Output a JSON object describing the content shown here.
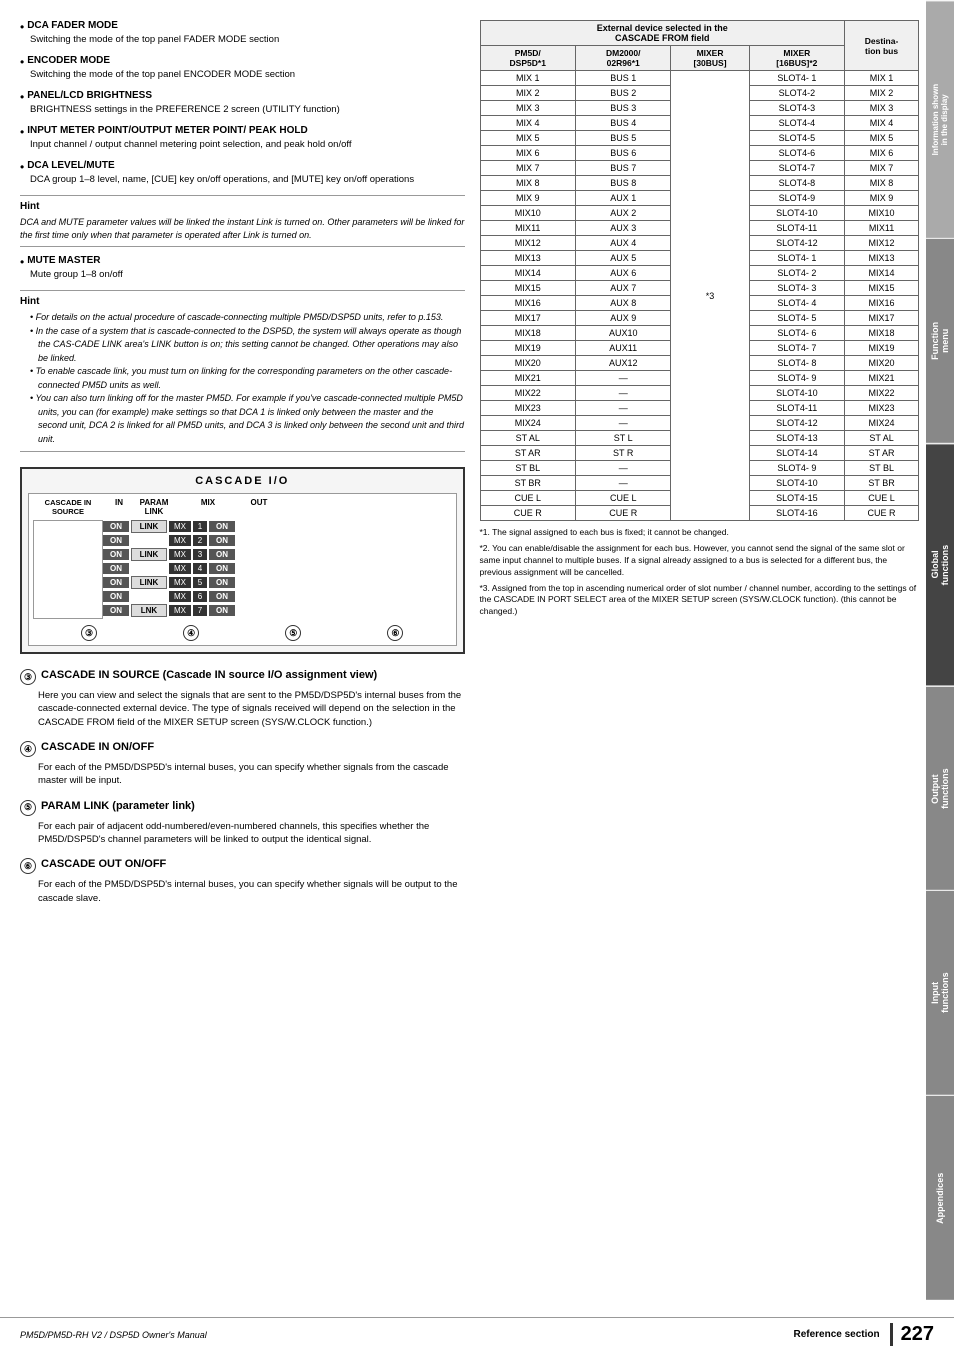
{
  "rightTabs": [
    {
      "label": "Information shown\nin the display",
      "active": false
    },
    {
      "label": "Function\nmenu",
      "active": false
    },
    {
      "label": "Global\nfunctions",
      "active": true
    },
    {
      "label": "Output\nfunctions",
      "active": false
    },
    {
      "label": "Input\nfunctions",
      "active": false
    },
    {
      "label": "Appendices",
      "active": false
    }
  ],
  "leftContent": {
    "bullets": [
      {
        "id": "dca-fader",
        "title": "DCA FADER MODE",
        "desc": "Switching the mode of the top panel FADER MODE section"
      },
      {
        "id": "encoder-mode",
        "title": "ENCODER MODE",
        "desc": "Switching the mode of the top panel ENCODER MODE section"
      },
      {
        "id": "panel-lcd",
        "title": "PANEL/LCD BRIGHTNESS",
        "desc": "BRIGHTNESS settings in the PREFERENCE 2 screen (UTILITY function)"
      },
      {
        "id": "input-meter",
        "title": "INPUT METER POINT/OUTPUT METER POINT/ PEAK HOLD",
        "desc": "Input channel / output channel metering point selection, and peak hold on/off"
      },
      {
        "id": "dca-level",
        "title": "DCA LEVEL/MUTE",
        "desc": "DCA group 1–8 level, name, [CUE] key on/off operations, and [MUTE] key on/off operations"
      }
    ],
    "hint1": {
      "title": "Hint",
      "text": "DCA and MUTE parameter values will be linked the instant Link is turned on. Other parameters will be linked for the first time only when that parameter is operated after Link is turned on."
    },
    "bullets2": [
      {
        "id": "mute-master",
        "title": "MUTE MASTER",
        "desc": "Mute group 1–8 on/off"
      }
    ],
    "hint2": {
      "title": "Hint",
      "bulletItems": [
        "For details on the actual procedure of cascade-connecting multiple PM5D/DSP5D units, refer to p.153.",
        "In the case of a system that is cascade-connected to the DSP5D, the system will always operate as though the CAS-CADE LINK area's LINK button is on; this setting cannot be changed. Other operations may also be linked.",
        "To enable cascade link, you must turn on linking for the corresponding parameters on the other cascade-connected PM5D units as well.",
        "You can also turn linking off for the master PM5D. For example if you've cascade-connected multiple PM5D units, you can (for example) make settings so that DCA 1 is linked only between the master and the second unit, DCA 2 is linked for all PM5D units, and DCA 3 is linked only between the second unit and third unit."
      ]
    },
    "diagram": {
      "title": "CASCADE I/O",
      "headers": [
        "CASCADE IN\nSOURCE",
        "IN",
        "PARAM\nLINK",
        "MIX",
        "OUT"
      ],
      "rows": [
        {
          "on": "ON",
          "link": "LINK",
          "mixes": [
            "MX 1"
          ],
          "out": "ON",
          "hasLink": true
        },
        {
          "on": "ON",
          "link": "",
          "mixes": [
            "MX 2"
          ],
          "out": "ON",
          "hasLink": false
        },
        {
          "on": "ON",
          "link": "LINK",
          "mixes": [
            "MX 3"
          ],
          "out": "ON",
          "hasLink": true
        },
        {
          "on": "ON",
          "link": "",
          "mixes": [
            "MX 4"
          ],
          "out": "ON",
          "hasLink": false
        },
        {
          "on": "ON",
          "link": "LINK",
          "mixes": [
            "MX 5"
          ],
          "out": "ON",
          "hasLink": true
        },
        {
          "on": "ON",
          "link": "",
          "mixes": [
            "MX 6"
          ],
          "out": "ON",
          "hasLink": false
        },
        {
          "on": "ON",
          "link": "LNK",
          "mixes": [
            "MX 7"
          ],
          "out": "ON",
          "hasLink": true
        }
      ],
      "circleLabels": [
        "③",
        "④",
        "⑤",
        "⑥"
      ]
    },
    "sections": [
      {
        "num": "③",
        "title": "CASCADE IN SOURCE (Cascade IN source I/O assignment view)",
        "body": "Here you can view and select the signals that are sent to the PM5D/DSP5D's internal buses from the cascade-connected external device. The type of signals received will depend on the selection in the CASCADE FROM field of the MIXER SETUP screen (SYS/W.CLOCK function.)"
      },
      {
        "num": "④",
        "title": "CASCADE IN ON/OFF",
        "body": "For each of the PM5D/DSP5D's internal buses, you can specify whether signals from the cascade master will be input."
      },
      {
        "num": "⑤",
        "title": "PARAM LINK (parameter link)",
        "body": "For each pair of adjacent odd-numbered/even-numbered channels, this specifies whether the PM5D/DSP5D's channel parameters will be linked to output the identical signal."
      },
      {
        "num": "⑥",
        "title": "CASCADE OUT ON/OFF",
        "body": "For each of the PM5D/DSP5D's internal buses, you can specify whether signals will be output to the cascade slave."
      }
    ]
  },
  "tableSection": {
    "title": "External device selected in the\nCASCADE FROM field",
    "destBusLabel": "Destina-\ntion bus",
    "headers": {
      "pm5d": "PM5D/\nDSP5D*1",
      "dm2000": "DM2000/\n02R96*1",
      "mixer30": "MIXER\n[30BUS]",
      "mixer16": "MIXER\n[16BUS]*2"
    },
    "rows": [
      {
        "pm5d": "MIX 1",
        "dm2000": "BUS 1",
        "mixer30": "",
        "mixer16": "SLOT4- 1",
        "dest": "MIX 1"
      },
      {
        "pm5d": "MIX 2",
        "dm2000": "BUS 2",
        "mixer30": "",
        "mixer16": "SLOT4-2",
        "dest": "MIX 2"
      },
      {
        "pm5d": "MIX 3",
        "dm2000": "BUS 3",
        "mixer30": "",
        "mixer16": "SLOT4-3",
        "dest": "MIX 3"
      },
      {
        "pm5d": "MIX 4",
        "dm2000": "BUS 4",
        "mixer30": "",
        "mixer16": "SLOT4-4",
        "dest": "MIX 4"
      },
      {
        "pm5d": "MIX 5",
        "dm2000": "BUS 5",
        "mixer30": "",
        "mixer16": "SLOT4-5",
        "dest": "MIX 5"
      },
      {
        "pm5d": "MIX 6",
        "dm2000": "BUS 6",
        "mixer30": "",
        "mixer16": "SLOT4-6",
        "dest": "MIX 6"
      },
      {
        "pm5d": "MIX 7",
        "dm2000": "BUS 7",
        "mixer30": "",
        "mixer16": "SLOT4-7",
        "dest": "MIX 7"
      },
      {
        "pm5d": "MIX 8",
        "dm2000": "BUS 8",
        "mixer30": "",
        "mixer16": "SLOT4-8",
        "dest": "MIX 8"
      },
      {
        "pm5d": "MIX 9",
        "dm2000": "AUX 1",
        "mixer30": "",
        "mixer16": "SLOT4-9",
        "dest": "MIX 9"
      },
      {
        "pm5d": "MIX10",
        "dm2000": "AUX 2",
        "mixer30": "",
        "mixer16": "SLOT4-10",
        "dest": "MIX10"
      },
      {
        "pm5d": "MIX11",
        "dm2000": "AUX 3",
        "mixer30": "",
        "mixer16": "SLOT4-11",
        "dest": "MIX11"
      },
      {
        "pm5d": "MIX12",
        "dm2000": "AUX 4",
        "mixer30": "",
        "mixer16": "SLOT4-12",
        "dest": "MIX12"
      },
      {
        "pm5d": "MIX13",
        "dm2000": "AUX 5",
        "mixer30": "",
        "mixer16": "SLOT4- 1",
        "dest": "MIX13"
      },
      {
        "pm5d": "MIX14",
        "dm2000": "AUX 6",
        "mixer30": "",
        "mixer16": "SLOT4- 2",
        "dest": "MIX14"
      },
      {
        "pm5d": "MIX15",
        "dm2000": "AUX 7",
        "mixer30": "*3",
        "mixer16": "SLOT4- 3",
        "dest": "MIX15"
      },
      {
        "pm5d": "MIX16",
        "dm2000": "AUX 8",
        "mixer30": "",
        "mixer16": "SLOT4- 4",
        "dest": "MIX16"
      },
      {
        "pm5d": "MIX17",
        "dm2000": "AUX 9",
        "mixer30": "",
        "mixer16": "SLOT4- 5",
        "dest": "MIX17"
      },
      {
        "pm5d": "MIX18",
        "dm2000": "AUX10",
        "mixer30": "",
        "mixer16": "SLOT4- 6",
        "dest": "MIX18"
      },
      {
        "pm5d": "MIX19",
        "dm2000": "AUX11",
        "mixer30": "",
        "mixer16": "SLOT4- 7",
        "dest": "MIX19"
      },
      {
        "pm5d": "MIX20",
        "dm2000": "AUX12",
        "mixer30": "",
        "mixer16": "SLOT4- 8",
        "dest": "MIX20"
      },
      {
        "pm5d": "MIX21",
        "dm2000": "—",
        "mixer30": "",
        "mixer16": "SLOT4- 9",
        "dest": "MIX21"
      },
      {
        "pm5d": "MIX22",
        "dm2000": "—",
        "mixer30": "",
        "mixer16": "SLOT4-10",
        "dest": "MIX22"
      },
      {
        "pm5d": "MIX23",
        "dm2000": "—",
        "mixer30": "",
        "mixer16": "SLOT4-11",
        "dest": "MIX23"
      },
      {
        "pm5d": "MIX24",
        "dm2000": "—",
        "mixer30": "",
        "mixer16": "SLOT4-12",
        "dest": "MIX24"
      },
      {
        "pm5d": "ST AL",
        "dm2000": "ST L",
        "mixer30": "",
        "mixer16": "SLOT4-13",
        "dest": "ST AL"
      },
      {
        "pm5d": "ST AR",
        "dm2000": "ST R",
        "mixer30": "",
        "mixer16": "SLOT4-14",
        "dest": "ST AR"
      },
      {
        "pm5d": "ST BL",
        "dm2000": "—",
        "mixer30": "",
        "mixer16": "SLOT4- 9",
        "dest": "ST BL"
      },
      {
        "pm5d": "ST BR",
        "dm2000": "—",
        "mixer30": "",
        "mixer16": "SLOT4-10",
        "dest": "ST BR"
      },
      {
        "pm5d": "CUE L",
        "dm2000": "CUE L",
        "mixer30": "",
        "mixer16": "SLOT4-15",
        "dest": "CUE L"
      },
      {
        "pm5d": "CUE R",
        "dm2000": "CUE R",
        "mixer30": "",
        "mixer16": "SLOT4-16",
        "dest": "CUE R"
      }
    ],
    "notes": [
      "*1.  The signal assigned to each bus is fixed; it cannot be changed.",
      "*2.  You can enable/disable the assignment for each bus. However, you cannot send the signal of the same slot or same input channel to multiple buses. If a signal already assigned to a bus is selected for a different bus, the previous assignment will be cancelled.",
      "*3.  Assigned from the top in ascending numerical order of slot number / channel number, according to the settings of the CASCADE IN PORT SELECT area of the MIXER SETUP screen (SYS/W.CLOCK function). (this cannot be changed.)"
    ]
  },
  "footer": {
    "title": "PM5D/PM5D-RH V2 / DSP5D Owner's Manual",
    "section": "Reference section",
    "pageNum": "227"
  }
}
